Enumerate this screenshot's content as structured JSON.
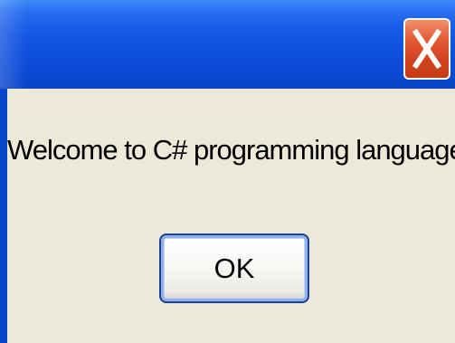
{
  "window": {
    "title": "",
    "close_icon": "close-x-icon"
  },
  "dialog": {
    "message": "Welcome to C# programming language",
    "ok_label": "OK"
  },
  "colors": {
    "titlebar": "#0f4fdd",
    "close_button": "#d2421c",
    "body": "#ece9d8",
    "button_border": "#1f3f8f"
  }
}
